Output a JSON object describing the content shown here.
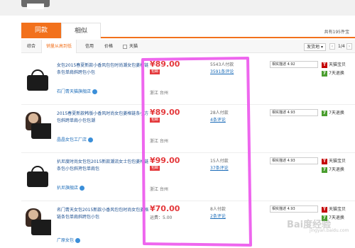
{
  "header": {
    "tabs": [
      {
        "label": "同款"
      },
      {
        "label": "相似"
      }
    ],
    "total": "共有195件宝"
  },
  "sortbar": {
    "items": [
      "综合",
      "销量从高到低",
      "信用",
      "价格"
    ],
    "tmall_label": "天猫",
    "ship_label": "发货地",
    "ship_arrow": "▾",
    "page": "1/4",
    "prev": "‹",
    "next": "›"
  },
  "rows": [
    {
      "title": "女包2015春夏新款小香风包包时尚潮女包菱格链条包单肩斜跨包小包",
      "shop": "石门青天猫旗舰店",
      "price": "¥89.00",
      "badge": "包邮",
      "location": "浙江 台州",
      "sales": "5543人付款",
      "reviews": "3591条评论",
      "match": "相实描述 4.92",
      "svc1": "天猫宝贝",
      "svc2": "7天退换"
    },
    {
      "title": "2015春夏新款韩版小香风时尚女包菱格链条小方包斜跨单肩小包包潮",
      "shop": "晶晶女包工厂店",
      "price": "¥89.00",
      "badge": "包邮",
      "location": "浙江 台州",
      "sales": "28人付款",
      "reviews": "4条评论",
      "match": "相实描述 4.93",
      "svc1": "7天退换",
      "svc2": ""
    },
    {
      "title": "扒尼度时尚女包包2015新款潮流女士包包菱格链条包小包斜挎包单肩包",
      "shop": "扒尼旗舰店",
      "price": "¥99.00",
      "badge": "包邮",
      "location": "浙江 台州",
      "sales": "15人付款",
      "reviews": "37条评论",
      "match": "相实描述 4.93",
      "svc1": "天猫宝贝",
      "svc2": "7天退换"
    },
    {
      "title": "名门青天女包2015新款小香风包包时尚女包菱格链条包单肩斜跨包小包",
      "shop": "广原女包",
      "price": "¥70.00",
      "badge": "",
      "location": "运费：5.00",
      "sales": "8人付款",
      "reviews": "2条评论",
      "match": "相实描述 4.93",
      "svc1": "天猫宝贝",
      "svc2": "7天退换"
    }
  ],
  "watermark": {
    "text": "Bai度经验",
    "sub": "jingyan.baidu.com"
  },
  "colors": {
    "accent": "#f2711c",
    "price": "#e4393c",
    "highlight": "#ee66ee"
  }
}
